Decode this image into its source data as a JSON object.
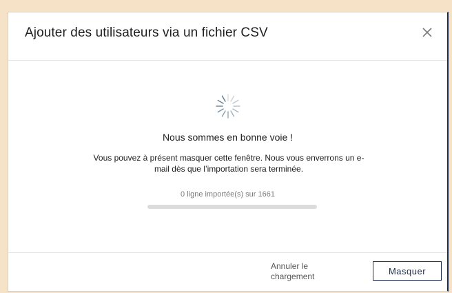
{
  "modal": {
    "title": "Ajouter des utilisateurs via un fichier CSV",
    "close_icon": "close-icon"
  },
  "status": {
    "spinner_icon": "loading-spinner-icon",
    "heading": "Nous sommes en bonne voie !",
    "message": "Vous pouvez à présent masquer cette fenêtre. Nous vous enverrons un e-mail dès que l’importation sera terminée."
  },
  "progress": {
    "label": "0 ligne importée(s) sur 1661",
    "imported": 0,
    "total": 1661
  },
  "footer": {
    "cancel_label": "Annuler le chargement",
    "hide_label": "Masquer"
  },
  "colors": {
    "backdrop": "#f6e3c7",
    "accent": "#1b2a4a",
    "progress_track": "#dcdcdc"
  }
}
